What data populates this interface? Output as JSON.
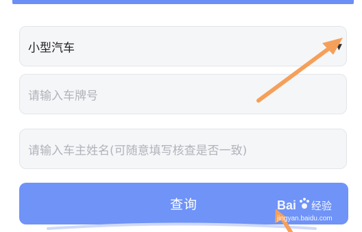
{
  "form": {
    "car_type": {
      "selected": "小型汽车"
    },
    "plate_input": {
      "placeholder": "请输入车牌号"
    },
    "owner_input": {
      "placeholder": "请输入车主姓名(可随意填写核查是否一致)"
    },
    "query_button_label": "查询"
  },
  "watermark": {
    "logo_text": "Bai经验",
    "url": "jingyan.baidu.com"
  },
  "colors": {
    "accent": "#6f93f6",
    "annotation_arrow": "#f5a05a",
    "field_bg": "#f5f6f8",
    "placeholder": "#b0b3b9"
  },
  "icons": {
    "dropdown": "triangle-down",
    "annotation": "arrow"
  }
}
